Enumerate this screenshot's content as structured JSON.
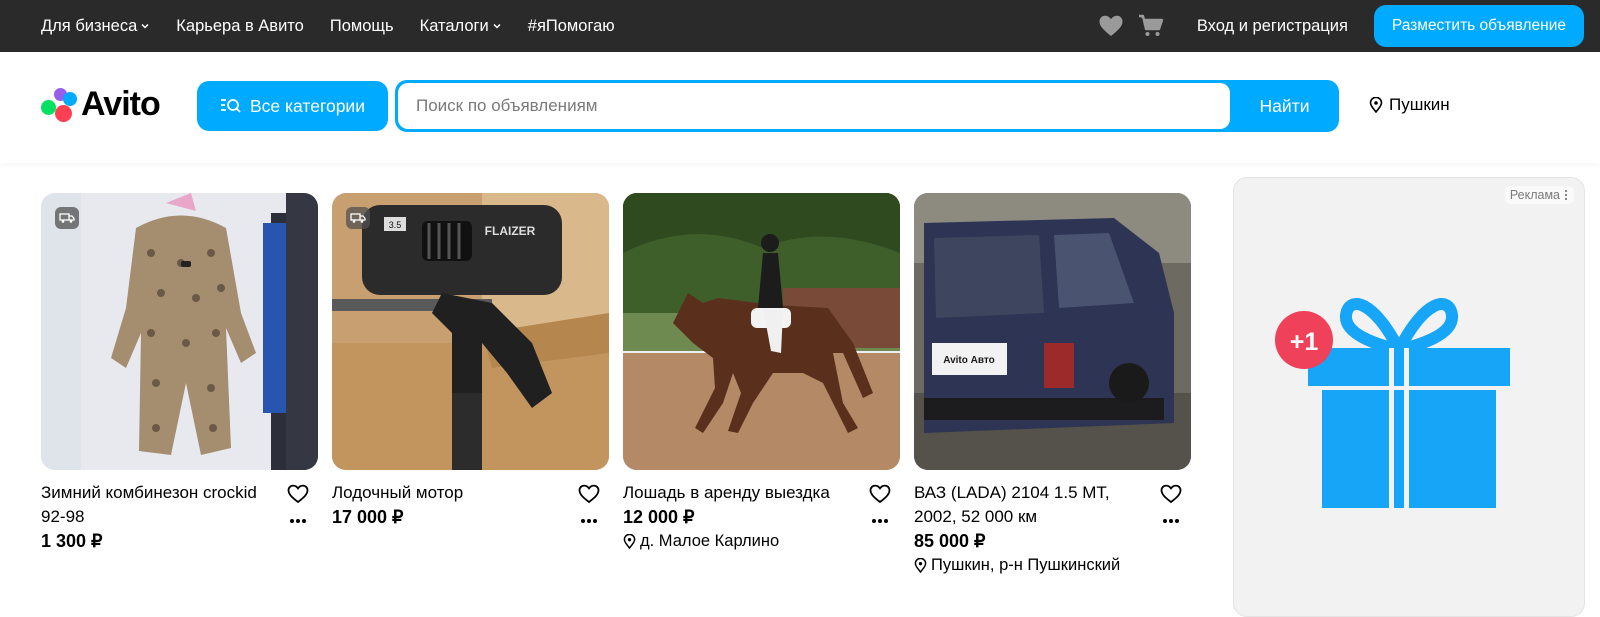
{
  "topnav": {
    "items": [
      {
        "label": "Для бизнеса",
        "dropdown": true
      },
      {
        "label": "Карьера в Авито",
        "dropdown": false
      },
      {
        "label": "Помощь",
        "dropdown": false
      },
      {
        "label": "Каталоги",
        "dropdown": true
      },
      {
        "label": "#яПомогаю",
        "dropdown": false
      }
    ],
    "login_label": "Вход и регистрация",
    "post_label": "Разместить объявление"
  },
  "header": {
    "logo_text": "Avito",
    "categories_label": "Все категории",
    "search_placeholder": "Поиск по объявлениям",
    "search_button": "Найти",
    "location": "Пушкин"
  },
  "cards": [
    {
      "title": "Зимний комбинезон crockid 92-98",
      "price": "1 300 ₽",
      "location": "",
      "delivery_badge": true
    },
    {
      "title": "Лодочный мотор",
      "price": "17 000 ₽",
      "location": "",
      "delivery_badge": true
    },
    {
      "title": "Лошадь в аренду выездка",
      "price": "12 000 ₽",
      "location": "д. Малое Карлино",
      "delivery_badge": false
    },
    {
      "title": "ВАЗ (LADA) 2104 1.5 MT, 2002, 52 000 км",
      "price": "85 000 ₽",
      "location": "Пушкин, р-н Пушкинский",
      "delivery_badge": false
    }
  ],
  "ad": {
    "label": "Реклама",
    "bonus": "+1"
  },
  "car_plate_text": "Avito Авто",
  "motor_label": "FLAIZER",
  "colors": {
    "accent": "#00aaff",
    "topbar": "#2a2a2a",
    "bonus_red": "#f0415a"
  }
}
